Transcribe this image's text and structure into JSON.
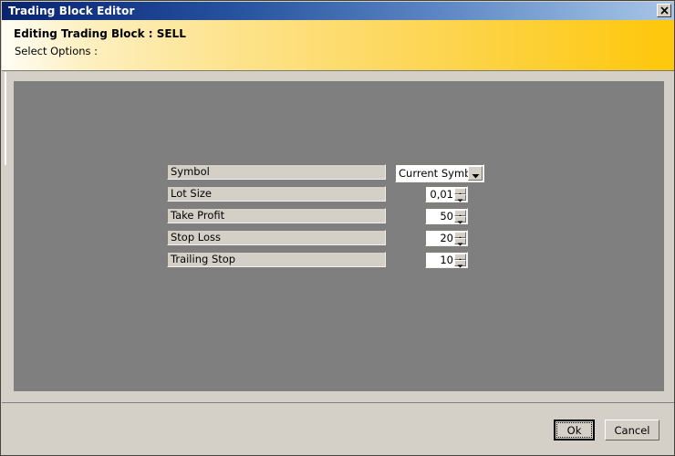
{
  "window": {
    "title": "Trading Block Editor",
    "close_icon": "close-x-icon"
  },
  "header": {
    "title": "Editing Trading Block : SELL",
    "subtitle": "Select Options :",
    "gradient_from": "#fffdf4",
    "gradient_to": "#fec70a"
  },
  "panel": {
    "background": "#7f7f7f"
  },
  "form": {
    "rows": [
      {
        "label": "Symbol",
        "control": "combo",
        "value": "Current Symbol",
        "arrow_icon": "chevron-down-icon"
      },
      {
        "label": "Lot Size",
        "control": "spinner",
        "value": "0,01",
        "up_icon": "spin-up-arrow-icon",
        "down_icon": "spin-down-arrow-icon"
      },
      {
        "label": "Take Profit",
        "control": "spinner",
        "value": "50",
        "up_icon": "spin-up-arrow-icon",
        "down_icon": "spin-down-arrow-icon"
      },
      {
        "label": "Stop Loss",
        "control": "spinner",
        "value": "20",
        "up_icon": "spin-up-arrow-icon",
        "down_icon": "spin-down-arrow-icon"
      },
      {
        "label": "Trailing Stop",
        "control": "spinner",
        "value": "10",
        "up_icon": "spin-up-arrow-icon",
        "down_icon": "spin-down-arrow-icon"
      }
    ]
  },
  "footer": {
    "ok_label": "Ok",
    "cancel_label": "Cancel"
  }
}
